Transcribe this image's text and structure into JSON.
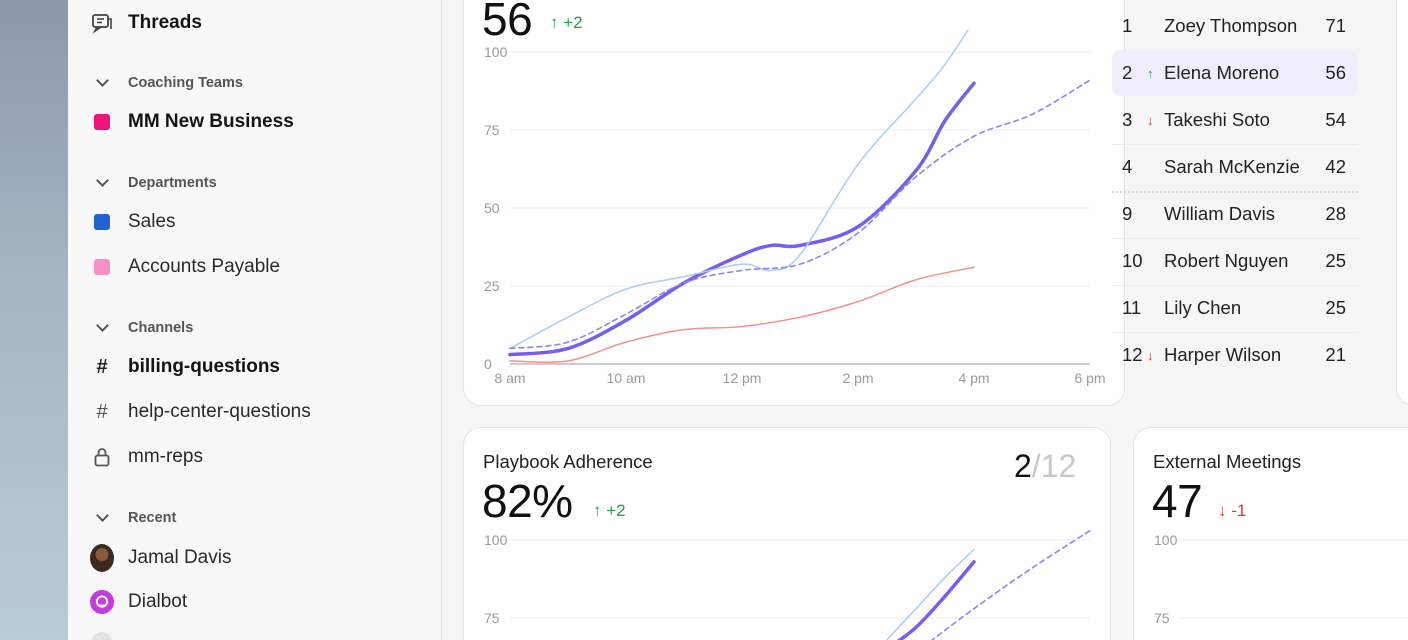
{
  "sidebar": {
    "threads_label": "Threads",
    "sections": [
      {
        "heading": "Coaching Teams",
        "items": [
          {
            "label": "MM New Business",
            "color": "#f0137e",
            "bold": true
          }
        ]
      },
      {
        "heading": "Departments",
        "items": [
          {
            "label": "Sales",
            "color": "#1f63d0"
          },
          {
            "label": "Accounts Payable",
            "color": "#f78fc6"
          }
        ]
      },
      {
        "heading": "Channels",
        "items": [
          {
            "label": "billing-questions",
            "icon": "hash-icon",
            "bold": true
          },
          {
            "label": "help-center-questions",
            "icon": "hash-icon"
          },
          {
            "label": "mm-reps",
            "icon": "lock-icon"
          }
        ]
      },
      {
        "heading": "Recent",
        "items": [
          {
            "label": "Jamal Davis",
            "icon": "avatar"
          },
          {
            "label": "Dialbot",
            "icon": "dialbot-icon"
          }
        ]
      }
    ]
  },
  "top_card": {
    "value": "56",
    "delta": "+2",
    "delta_dir": "up"
  },
  "leaderboard": [
    {
      "rank": "1",
      "name": "Zoey Thompson",
      "score": "71",
      "trend": ""
    },
    {
      "rank": "2",
      "name": "Elena Moreno",
      "score": "56",
      "trend": "up",
      "highlight": true
    },
    {
      "rank": "3",
      "name": "Takeshi Soto",
      "score": "54",
      "trend": "down"
    },
    {
      "rank": "4",
      "name": "Sarah McKenzie",
      "score": "42",
      "trend": ""
    },
    {
      "rank": "9",
      "name": "William Davis",
      "score": "28",
      "trend": ""
    },
    {
      "rank": "10",
      "name": "Robert Nguyen",
      "score": "25",
      "trend": ""
    },
    {
      "rank": "11",
      "name": "Lily Chen",
      "score": "25",
      "trend": ""
    },
    {
      "rank": "12",
      "name": "Harper Wilson",
      "score": "21",
      "trend": "down"
    }
  ],
  "playbook_card": {
    "title": "Playbook Adherence",
    "value": "82%",
    "delta": "+2",
    "delta_dir": "up",
    "rank": "2",
    "rank_total": "/12"
  },
  "meetings_card": {
    "title": "External Meetings",
    "value": "47",
    "delta": "-1",
    "delta_dir": "down"
  },
  "colors": {
    "accent": "#7b5cf0",
    "light_blue": "#a9cdf3",
    "red": "#f0928b",
    "up": "#22a04b",
    "down": "#d63a2f"
  },
  "chart_data": [
    {
      "type": "line",
      "x_ticks": [
        "8 am",
        "10 am",
        "12 pm",
        "2 pm",
        "4 pm",
        "6 pm"
      ],
      "y_ticks": [
        "0",
        "25",
        "50",
        "75",
        "100"
      ],
      "ylim": [
        0,
        100
      ],
      "xlim": [
        8,
        18
      ],
      "series": [
        {
          "style": "solid-thick",
          "color": "#7b5cf0",
          "x": [
            8,
            9,
            10,
            11,
            12,
            12.5,
            13,
            14,
            15,
            15.5,
            16
          ],
          "y": [
            3,
            5,
            14,
            26,
            35,
            38,
            38,
            44,
            62,
            78,
            90
          ]
        },
        {
          "style": "solid-thin",
          "color": "#a9cdf3",
          "x": [
            8,
            9,
            10,
            11,
            12,
            12.5,
            13,
            14,
            15,
            15.5,
            16
          ],
          "y": [
            5,
            15,
            24,
            28,
            32,
            30,
            35,
            64,
            85,
            96,
            110
          ]
        },
        {
          "style": "dashed",
          "color": "#8e86f0",
          "x": [
            8,
            9,
            10,
            11,
            12,
            13,
            14,
            15,
            16,
            17,
            18
          ],
          "y": [
            5,
            7,
            16,
            26,
            30,
            32,
            42,
            60,
            73,
            80,
            91
          ]
        },
        {
          "style": "solid-thin",
          "color": "#f0928b",
          "x": [
            8,
            9,
            10,
            11,
            12,
            13,
            14,
            15,
            16
          ],
          "y": [
            1,
            1,
            7,
            11,
            12,
            15,
            20,
            27,
            31
          ]
        }
      ]
    },
    {
      "type": "line",
      "y_ticks": [
        "75",
        "100"
      ],
      "ylim": [
        0,
        100
      ],
      "xlim": [
        8,
        18
      ],
      "series": [
        {
          "style": "solid-thick",
          "color": "#7b5cf0",
          "x": [
            14.5,
            15,
            15.5,
            16
          ],
          "y": [
            65,
            72,
            82,
            93
          ]
        },
        {
          "style": "solid-thin",
          "color": "#a9cdf3",
          "x": [
            14.5,
            15,
            15.5,
            16
          ],
          "y": [
            68,
            78,
            88,
            97
          ]
        },
        {
          "style": "dashed",
          "color": "#8e86f0",
          "x": [
            15,
            16,
            17,
            18
          ],
          "y": [
            64,
            78,
            91,
            103
          ]
        }
      ]
    },
    {
      "type": "line",
      "y_ticks": [
        "75",
        "100"
      ],
      "ylim": [
        0,
        100
      ],
      "series": []
    }
  ]
}
